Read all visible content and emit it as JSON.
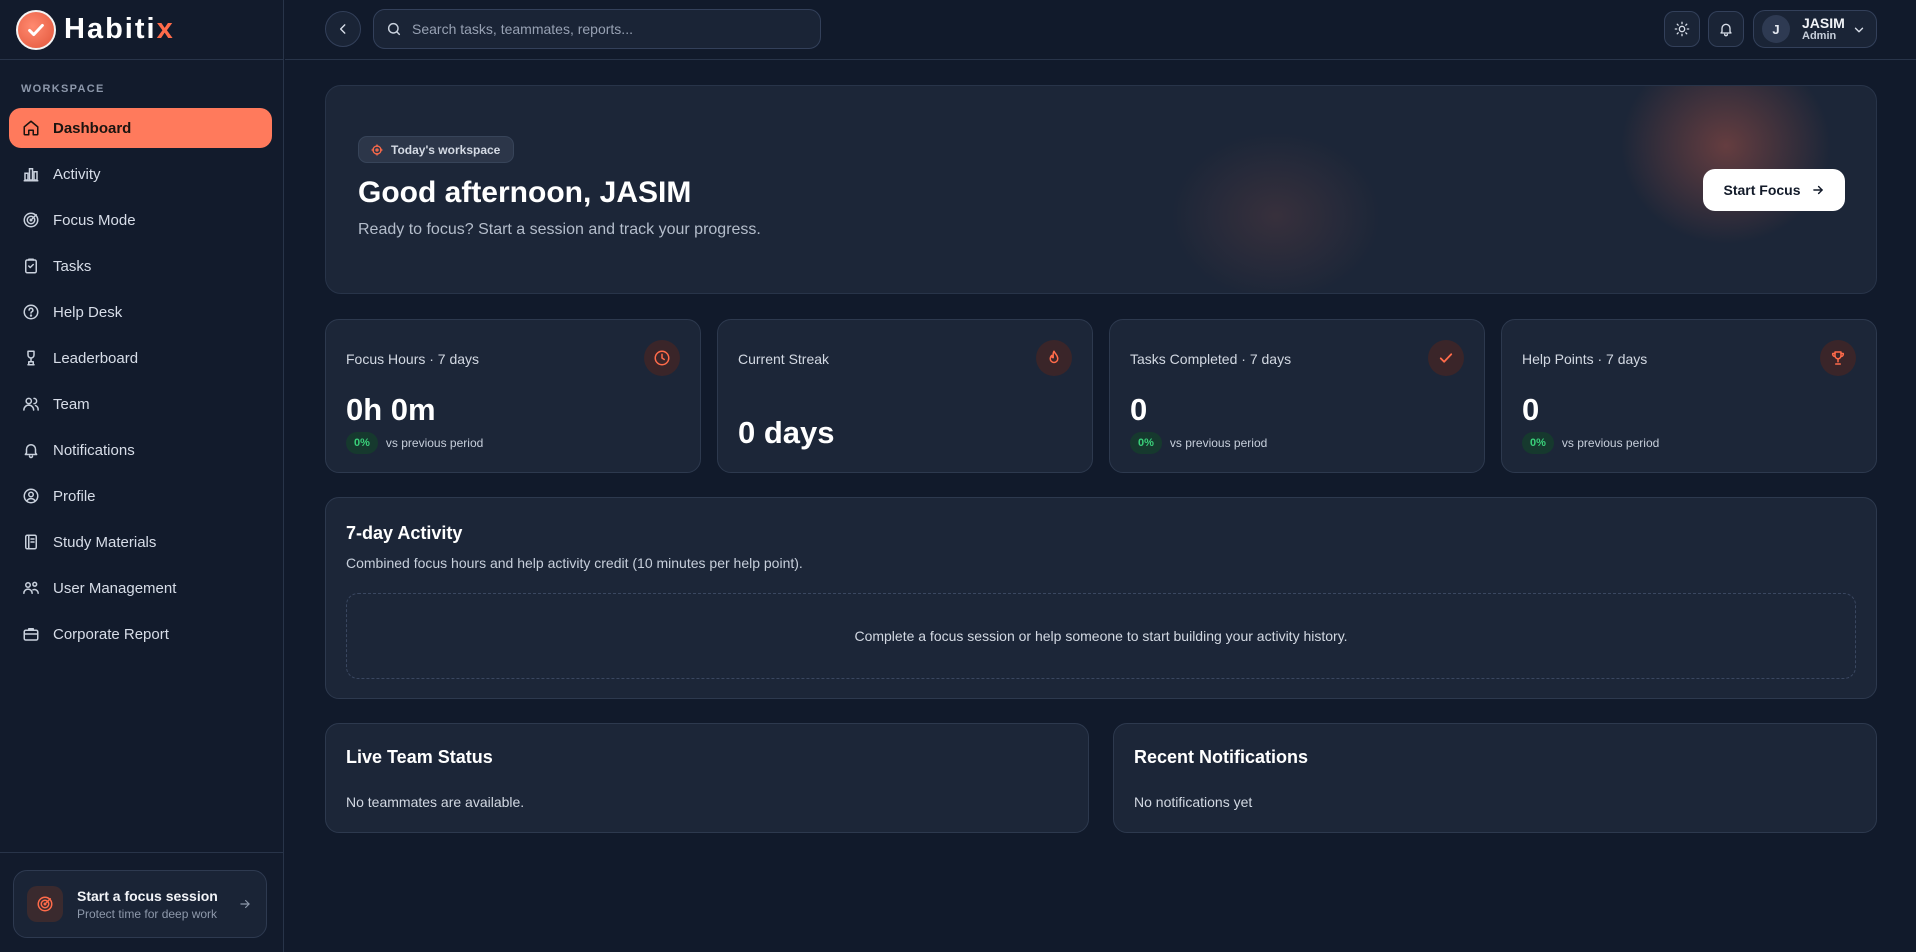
{
  "brand": {
    "name_main": "Habiti",
    "name_accent": "x"
  },
  "sidebar": {
    "section_label": "WORKSPACE",
    "items": [
      {
        "label": "Dashboard",
        "icon": "home-icon",
        "active": true
      },
      {
        "label": "Activity",
        "icon": "bar-chart-icon"
      },
      {
        "label": "Focus Mode",
        "icon": "target-icon"
      },
      {
        "label": "Tasks",
        "icon": "clipboard-icon"
      },
      {
        "label": "Help Desk",
        "icon": "help-circle-icon"
      },
      {
        "label": "Leaderboard",
        "icon": "award-icon"
      },
      {
        "label": "Team",
        "icon": "users-icon"
      },
      {
        "label": "Notifications",
        "icon": "bell-icon"
      },
      {
        "label": "Profile",
        "icon": "user-circle-icon"
      },
      {
        "label": "Study Materials",
        "icon": "book-icon"
      },
      {
        "label": "User Management",
        "icon": "user-cog-icon"
      },
      {
        "label": "Corporate Report",
        "icon": "briefcase-icon"
      }
    ],
    "focus_card": {
      "title": "Start a focus session",
      "subtitle": "Protect time for deep work"
    }
  },
  "topbar": {
    "search_placeholder": "Search tasks, teammates, reports...",
    "user": {
      "initial": "J",
      "name": "JASIM",
      "role": "Admin"
    }
  },
  "hero": {
    "tag": "Today's workspace",
    "title": "Good afternoon, JASIM",
    "subtitle": "Ready to focus? Start a session and track your progress.",
    "cta": "Start Focus"
  },
  "stats": [
    {
      "label": "Focus Hours · 7 days",
      "value": "0h 0m",
      "badge": "0%",
      "vs": "vs previous period",
      "icon": "clock-icon"
    },
    {
      "label": "Current Streak",
      "value": "0 days",
      "icon": "flame-icon"
    },
    {
      "label": "Tasks Completed · 7 days",
      "value": "0",
      "badge": "0%",
      "vs": "vs previous period",
      "icon": "check-icon"
    },
    {
      "label": "Help Points · 7 days",
      "value": "0",
      "badge": "0%",
      "vs": "vs previous period",
      "icon": "trophy-icon"
    }
  ],
  "activity": {
    "title": "7-day Activity",
    "subtitle": "Combined focus hours and help activity credit (10 minutes per help point).",
    "empty": "Complete a focus session or help someone to start building your activity history."
  },
  "team_status": {
    "title": "Live Team Status",
    "empty": "No teammates are available."
  },
  "notifications": {
    "title": "Recent Notifications",
    "empty": "No notifications yet"
  },
  "colors": {
    "accent": "#ff7a5c",
    "background": "#111a2b",
    "card": "#1c2638",
    "success": "#3ad07a"
  }
}
